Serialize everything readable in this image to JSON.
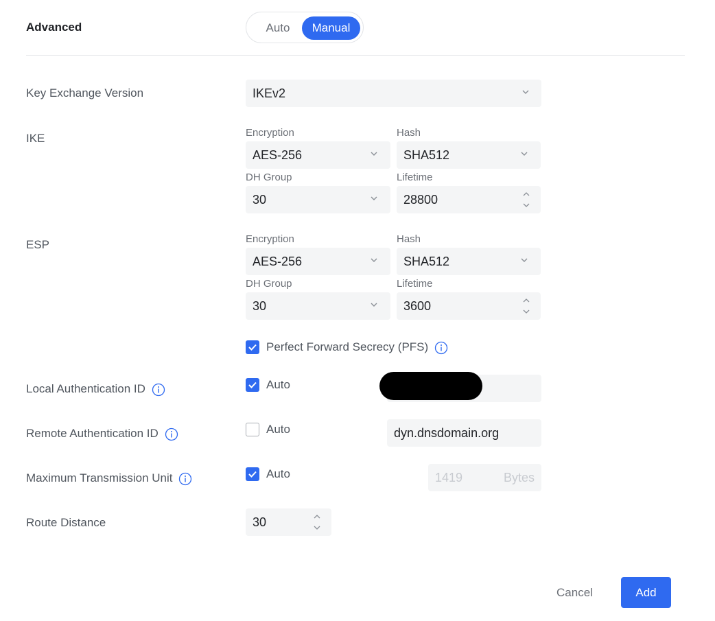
{
  "section": {
    "title": "Advanced"
  },
  "mode_toggle": {
    "options": [
      "Auto",
      "Manual"
    ],
    "selected": "Manual"
  },
  "key_exchange": {
    "label": "Key Exchange Version",
    "value": "IKEv2"
  },
  "ike": {
    "label": "IKE",
    "encryption_label": "Encryption",
    "encryption": "AES-256",
    "hash_label": "Hash",
    "hash": "SHA512",
    "dh_label": "DH Group",
    "dh": "30",
    "lifetime_label": "Lifetime",
    "lifetime": "28800"
  },
  "esp": {
    "label": "ESP",
    "encryption_label": "Encryption",
    "encryption": "AES-256",
    "hash_label": "Hash",
    "hash": "SHA512",
    "dh_label": "DH Group",
    "dh": "30",
    "lifetime_label": "Lifetime",
    "lifetime": "3600"
  },
  "pfs": {
    "label": "Perfect Forward Secrecy (PFS)",
    "checked": true
  },
  "local_auth": {
    "label": "Local Authentication ID",
    "auto_label": "Auto",
    "auto_checked": true,
    "value": ""
  },
  "remote_auth": {
    "label": "Remote Authentication ID",
    "auto_label": "Auto",
    "auto_checked": false,
    "value": "dyn.dnsdomain.org"
  },
  "mtu": {
    "label": "Maximum Transmission Unit",
    "auto_label": "Auto",
    "auto_checked": true,
    "value": "1419",
    "unit": "Bytes"
  },
  "route_distance": {
    "label": "Route Distance",
    "value": "30"
  },
  "actions": {
    "cancel": "Cancel",
    "add": "Add"
  },
  "colors": {
    "accent": "#2f6af0",
    "field_bg": "#f4f5f6",
    "label": "#50565e"
  }
}
